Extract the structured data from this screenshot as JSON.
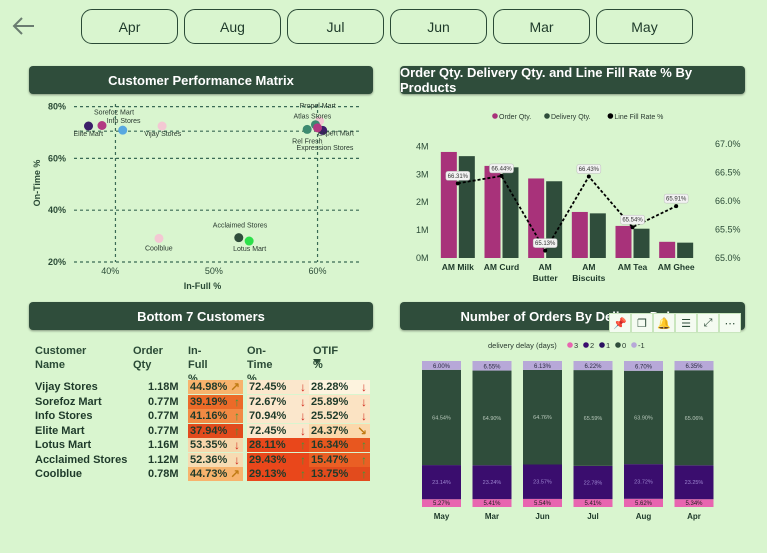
{
  "months": [
    "Apr",
    "Aug",
    "Jul",
    "Jun",
    "Mar",
    "May"
  ],
  "colors": {
    "header_bg": "#2f4d3b",
    "order": "#a8327a",
    "delivery": "#2f4d3b",
    "page_bg": "#d9f5cf"
  },
  "matrix": {
    "title": "Customer Performance Matrix",
    "chart_data": {
      "type": "scatter",
      "xlabel": "In-Full %",
      "ylabel": "On-Time %",
      "xlim": [
        36.5,
        64
      ],
      "ylim": [
        20,
        81
      ],
      "xticks": [
        "40%",
        "50%",
        "60%"
      ],
      "yticks": [
        "80%",
        "60%",
        "40%",
        "20%"
      ],
      "ref_x": [
        40.5,
        60
      ],
      "ref_y": [
        70.5
      ],
      "points": [
        {
          "label": "Sorefoz Mart",
          "x": 39.2,
          "y": 72.7,
          "color": "#b23a82"
        },
        {
          "label": "Info Stores",
          "x": 41.2,
          "y": 70.9,
          "color": "#58a8e0"
        },
        {
          "label": "Elite Mart",
          "x": 37.9,
          "y": 72.5,
          "color": "#3b1f68"
        },
        {
          "label": "Vijay Stores",
          "x": 45.0,
          "y": 72.5,
          "color": "#f3c8d3"
        },
        {
          "label": "Propel Mart",
          "x": 60.2,
          "y": 74.5,
          "color": "#f3c8d3"
        },
        {
          "label": "Atlas Stores",
          "x": 59.8,
          "y": 73.0,
          "color": "#3d8a70"
        },
        {
          "label": "Rel Fresh",
          "x": 59.0,
          "y": 71.2,
          "color": "#3d8a70"
        },
        {
          "label": "Expert Mart",
          "x": 60.5,
          "y": 70.8,
          "color": "#3b1f68"
        },
        {
          "label": "Expression Stores",
          "x": 60.0,
          "y": 71.8,
          "color": "#b23a82"
        },
        {
          "label": "Acclaimed Stores",
          "x": 52.4,
          "y": 29.4,
          "color": "#2f4d3b"
        },
        {
          "label": "Lotus Mart",
          "x": 53.4,
          "y": 28.1,
          "color": "#2de04a"
        },
        {
          "label": "Coolblue",
          "x": 44.7,
          "y": 29.1,
          "color": "#f3c8d3"
        }
      ]
    }
  },
  "orders": {
    "title": "Order Qty. Delivery Qty. and Line Fill Rate % By Products",
    "chart_data": {
      "type": "bar",
      "categories": [
        "AM Milk",
        "AM Curd",
        "AM Butter",
        "AM Biscuits",
        "AM Tea",
        "AM Ghee"
      ],
      "series": [
        {
          "name": "Order Qty.",
          "values": [
            3.8,
            3.3,
            2.85,
            1.65,
            1.15,
            0.58
          ]
        },
        {
          "name": "Delivery Qty.",
          "values": [
            3.65,
            3.25,
            2.75,
            1.6,
            1.05,
            0.55
          ]
        }
      ],
      "line": {
        "name": "Line Fill Rate %",
        "values": [
          66.31,
          66.44,
          65.13,
          66.43,
          65.54,
          65.91
        ],
        "labels": [
          "66.31%",
          "66.44%",
          "65.13%",
          "66.43%",
          "65.54%",
          "65.91%"
        ]
      },
      "ylim": [
        0,
        4.3
      ],
      "y2lim": [
        65,
        67
      ],
      "yticks": [
        "4M",
        "3M",
        "2M",
        "1M",
        "0M"
      ],
      "y2ticks": [
        "67.0%",
        "66.5%",
        "66.0%",
        "65.5%",
        "65.0%"
      ],
      "legend": "top"
    }
  },
  "bottom": {
    "title": "Bottom 7 Customers",
    "headers": [
      "Customer Name",
      "Order Qty",
      "In-Full %",
      "On-Time %",
      "OTIF %"
    ],
    "rows": [
      {
        "name": "Vijay Stores",
        "qty": "1.18M",
        "infull": "44.98%",
        "ontime": "72.45%",
        "otif": "28.28%",
        "a1": "↗",
        "a2": "↓",
        "a3": "↓"
      },
      {
        "name": "Sorefoz Mart",
        "qty": "0.77M",
        "infull": "39.19%",
        "ontime": "72.67%",
        "otif": "25.89%",
        "a1": "↑",
        "a2": "↓",
        "a3": "↓"
      },
      {
        "name": "Info Stores",
        "qty": "0.77M",
        "infull": "41.16%",
        "ontime": "70.94%",
        "otif": "25.52%",
        "a1": "↑",
        "a2": "↓",
        "a3": "↓"
      },
      {
        "name": "Elite Mart",
        "qty": "0.77M",
        "infull": "37.94%",
        "ontime": "72.45%",
        "otif": "24.37%",
        "a1": "↑",
        "a2": "↓",
        "a3": "↘"
      },
      {
        "name": "Lotus Mart",
        "qty": "1.16M",
        "infull": "53.35%",
        "ontime": "28.11%",
        "otif": "16.34%",
        "a1": "↓",
        "a2": "↑",
        "a3": "↑"
      },
      {
        "name": "Acclaimed Stores",
        "qty": "1.12M",
        "infull": "52.36%",
        "ontime": "29.43%",
        "otif": "15.47%",
        "a1": "↓",
        "a2": "↑",
        "a3": "↑"
      },
      {
        "name": "Coolblue",
        "qty": "0.78M",
        "infull": "44.73%",
        "ontime": "29.13%",
        "otif": "13.75%",
        "a1": "↗",
        "a2": "↑",
        "a3": "↑"
      }
    ]
  },
  "delay": {
    "title": "Number of Orders By Delivery Delay",
    "legend_title": "delivery delay (days)",
    "chart_data": {
      "type": "bar",
      "stacked": true,
      "categories": [
        "May",
        "Mar",
        "Jun",
        "Jul",
        "Aug",
        "Apr"
      ],
      "series": [
        {
          "name": "3",
          "color": "#e865b0",
          "values": [
            5.27,
            5.41,
            5.54,
            5.41,
            5.62,
            5.34
          ]
        },
        {
          "name": "2",
          "color": "#3a0d6e",
          "values": [
            23.14,
            23.24,
            23.57,
            22.78,
            23.72,
            23.25
          ]
        },
        {
          "name": "0",
          "color": "#2f4d3b",
          "values": [
            64.54,
            64.9,
            64.76,
            65.59,
            63.9,
            65.06
          ]
        },
        {
          "name": "-1",
          "color": "#b7a8d8",
          "values": [
            6.0,
            6.55,
            6.13,
            6.22,
            6.7,
            6.35
          ]
        }
      ],
      "legend_entries": [
        "3",
        "2",
        "1",
        "0",
        "-1"
      ],
      "legend_colors": [
        "#e865b0",
        "#3a0d6e",
        "#2a1060",
        "#2f4d3b",
        "#b7a8d8"
      ],
      "top_labels": [
        "6.00%",
        "6.55%",
        "6.13%",
        "6.22%",
        "6.70%",
        "6.35%"
      ],
      "mid_labels": [
        "64.54%",
        "64.90%",
        "64.76%",
        "65.59%",
        "63.90%",
        "65.06%"
      ],
      "low_labels": [
        "23.14%",
        "23.24%",
        "23.57%",
        "22.78%",
        "23.72%",
        "23.25%"
      ],
      "bottom_labels": [
        "5.27%",
        "5.41%",
        "5.54%",
        "5.41%",
        "5.62%",
        "5.34%"
      ]
    }
  }
}
